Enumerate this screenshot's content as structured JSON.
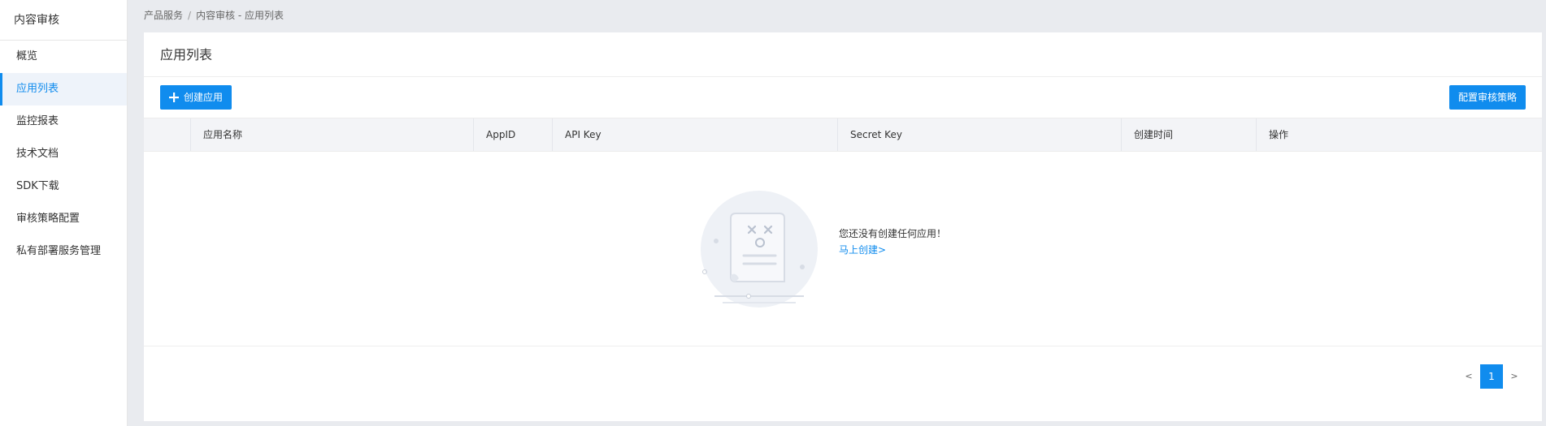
{
  "sidebar": {
    "title": "内容审核",
    "items": [
      {
        "label": "概览"
      },
      {
        "label": "应用列表"
      },
      {
        "label": "监控报表"
      },
      {
        "label": "技术文档"
      },
      {
        "label": "SDK下载"
      },
      {
        "label": "审核策略配置"
      },
      {
        "label": "私有部署服务管理"
      }
    ],
    "active_index": 1
  },
  "breadcrumb": {
    "parent": "产品服务",
    "separator": "/",
    "current": "内容审核 - 应用列表"
  },
  "card": {
    "title": "应用列表"
  },
  "toolbar": {
    "create_label": "创建应用",
    "create_icon": "plus-icon",
    "policy_label": "配置审核策略"
  },
  "table": {
    "columns": [
      "应用名称",
      "AppID",
      "API Key",
      "Secret Key",
      "创建时间",
      "操作"
    ],
    "rows": []
  },
  "empty_state": {
    "message": "您还没有创建任何应用！",
    "link": "马上创建>",
    "illustration": "empty-document-icon"
  },
  "pagination": {
    "prev": "<",
    "current_page": "1",
    "next": ">"
  },
  "colors": {
    "accent": "#108cee",
    "background": "#e9ebef",
    "table_header": "#f3f4f7"
  }
}
